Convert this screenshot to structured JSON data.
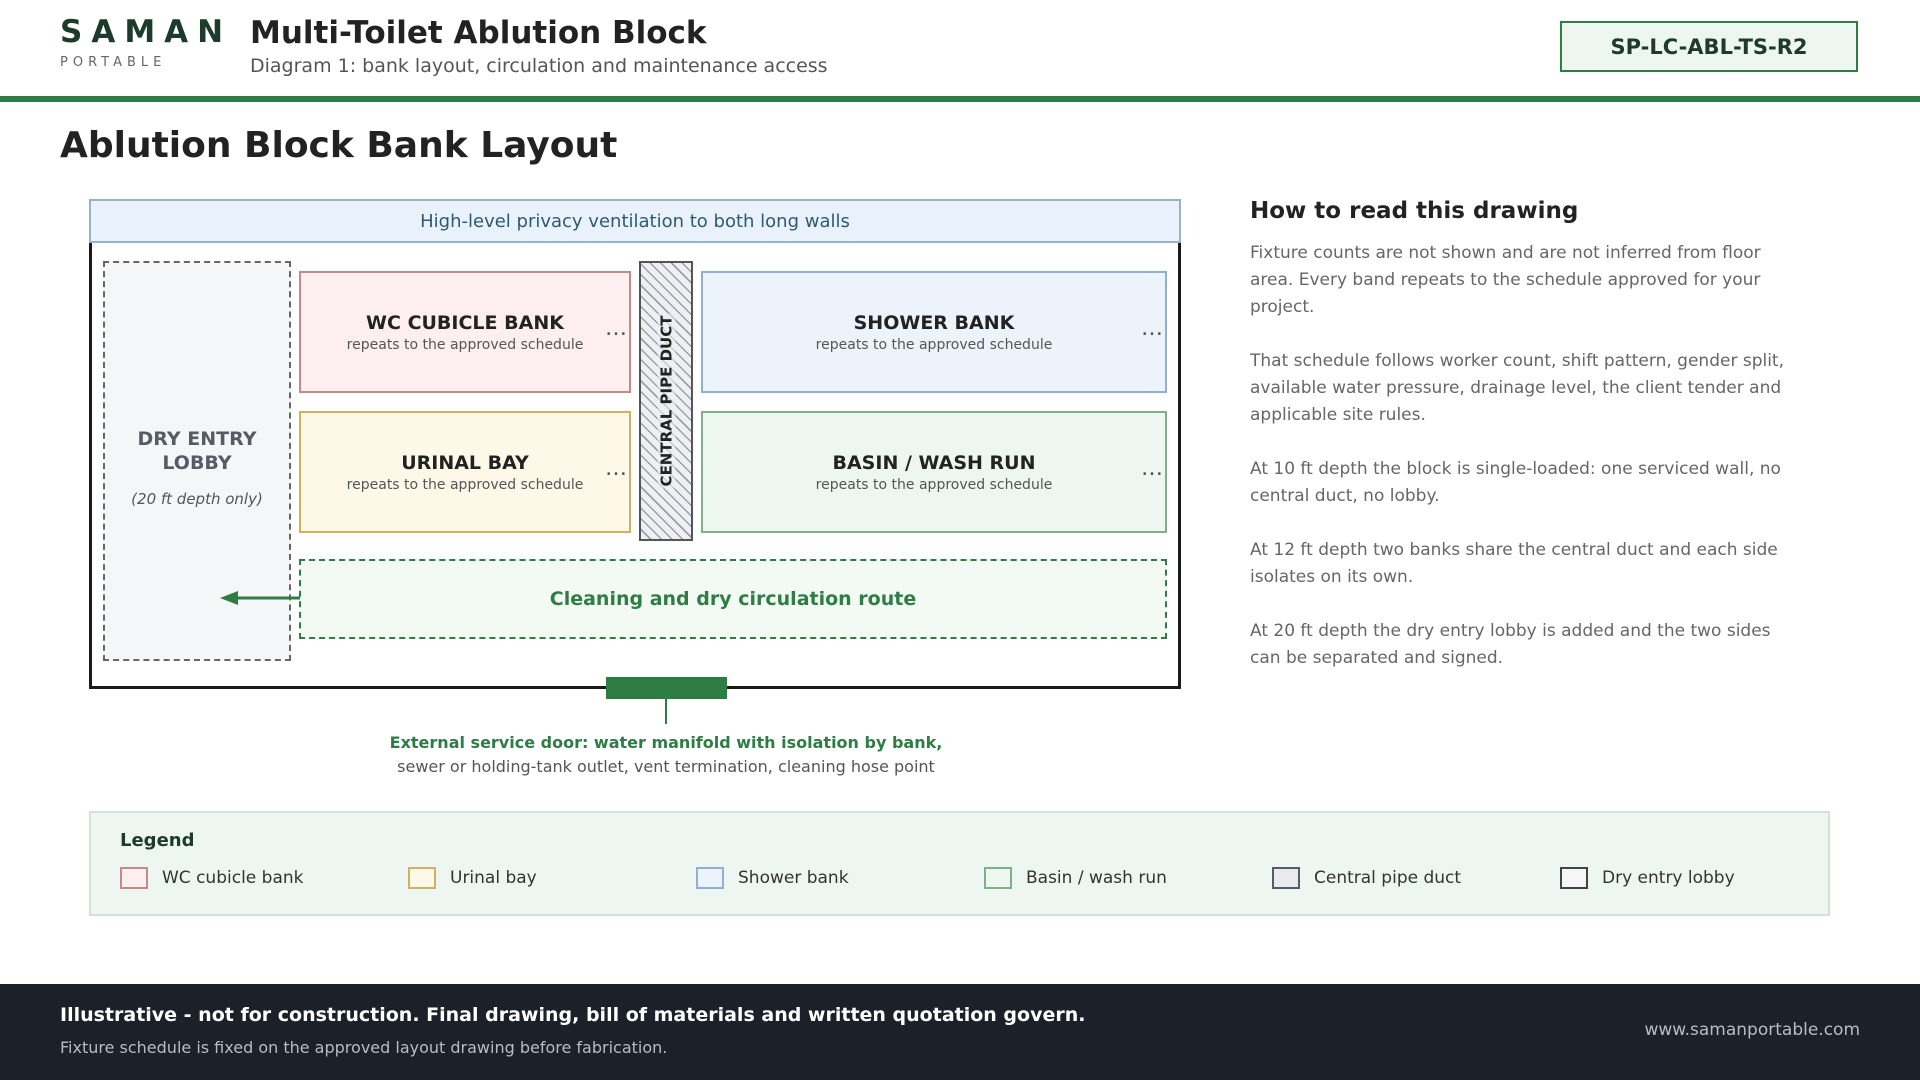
{
  "header": {
    "logo_word": "SAMAN",
    "logo_sub": "PORTABLE",
    "title": "Multi-Toilet Ablution Block",
    "subtitle": "Diagram 1: bank layout, circulation and maintenance access",
    "code": "SP-LC-ABL-TS-R2"
  },
  "page_title": "Ablution Block Bank Layout",
  "diagram": {
    "ventilation": "High-level privacy ventilation to both long walls",
    "lobby": {
      "title": "DRY ENTRY LOBBY",
      "note": "(20 ft depth only)"
    },
    "banks": {
      "wc": {
        "name": "WC CUBICLE BANK",
        "note": "repeats to the approved schedule",
        "more": "…"
      },
      "urinal": {
        "name": "URINAL BAY",
        "note": "repeats to the approved schedule",
        "more": "…"
      },
      "shower": {
        "name": "SHOWER BANK",
        "note": "repeats to the approved schedule",
        "more": "…"
      },
      "basin": {
        "name": "BASIN / WASH RUN",
        "note": "repeats to the approved schedule",
        "more": "…"
      }
    },
    "duct_label": "CENTRAL PIPE DUCT",
    "route_label": "Cleaning and dry circulation route",
    "door": {
      "line1": "External service door: water manifold with isolation by bank,",
      "line2": "sewer or holding-tank outlet, vent termination, cleaning hose point"
    },
    "colors": {
      "accent": "#2e7d44",
      "wc_fill": "#fdeff0",
      "urinal_fill": "#fef8e8",
      "shower_fill": "#edf3fb",
      "basin_fill": "#edf7ef"
    }
  },
  "how_to_read": {
    "title": "How to read this drawing",
    "paragraphs": [
      "Fixture counts are not shown and are not inferred from floor area. Every band repeats to the schedule approved for your project.",
      "That schedule follows worker count, shift pattern, gender split, available water pressure, drainage level, the client tender and applicable site rules.",
      "At 10 ft depth the block is single-loaded: one serviced wall, no central duct, no lobby.",
      "At 12 ft depth two banks share the central duct and each side isolates on its own.",
      "At 20 ft depth the dry entry lobby is added and the two sides can be separated and signed."
    ]
  },
  "legend": {
    "title": "Legend",
    "items": [
      {
        "label": "WC cubicle bank",
        "fill": "#fdeff0",
        "stroke": "#c48a8a"
      },
      {
        "label": "Urinal bay",
        "fill": "#fef8e8",
        "stroke": "#d2b060"
      },
      {
        "label": "Shower bank",
        "fill": "#edf3fb",
        "stroke": "#8fb0d2"
      },
      {
        "label": "Basin / wash run",
        "fill": "#edf7ef",
        "stroke": "#7fb08c"
      },
      {
        "label": "Central pipe duct",
        "fill": "#e8eaed",
        "stroke": "#555c66"
      },
      {
        "label": "Dry entry lobby",
        "fill": "#f4f6f8",
        "stroke": "#444"
      }
    ]
  },
  "footer": {
    "main": "Illustrative - not for construction. Final drawing, bill of materials and written quotation govern.",
    "sub": "Fixture schedule is fixed on the approved layout drawing before fabrication.",
    "url": "www.samanportable.com"
  }
}
